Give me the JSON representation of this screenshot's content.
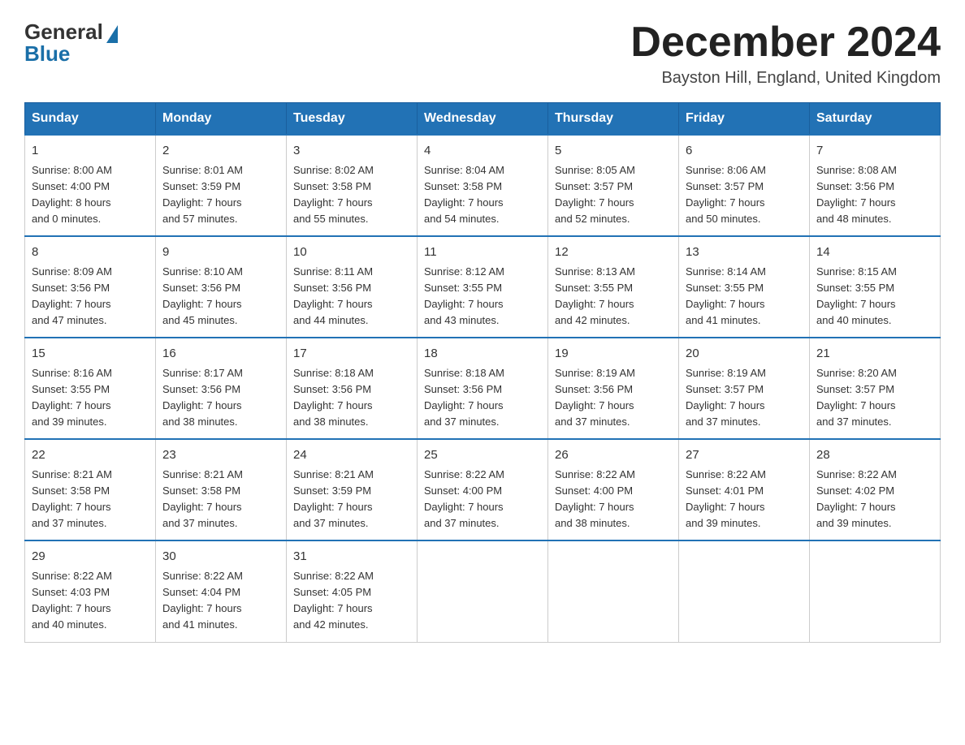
{
  "logo": {
    "general": "General",
    "blue": "Blue"
  },
  "header": {
    "month": "December 2024",
    "location": "Bayston Hill, England, United Kingdom"
  },
  "days_of_week": [
    "Sunday",
    "Monday",
    "Tuesday",
    "Wednesday",
    "Thursday",
    "Friday",
    "Saturday"
  ],
  "weeks": [
    [
      {
        "num": "1",
        "info": "Sunrise: 8:00 AM\nSunset: 4:00 PM\nDaylight: 8 hours\nand 0 minutes."
      },
      {
        "num": "2",
        "info": "Sunrise: 8:01 AM\nSunset: 3:59 PM\nDaylight: 7 hours\nand 57 minutes."
      },
      {
        "num": "3",
        "info": "Sunrise: 8:02 AM\nSunset: 3:58 PM\nDaylight: 7 hours\nand 55 minutes."
      },
      {
        "num": "4",
        "info": "Sunrise: 8:04 AM\nSunset: 3:58 PM\nDaylight: 7 hours\nand 54 minutes."
      },
      {
        "num": "5",
        "info": "Sunrise: 8:05 AM\nSunset: 3:57 PM\nDaylight: 7 hours\nand 52 minutes."
      },
      {
        "num": "6",
        "info": "Sunrise: 8:06 AM\nSunset: 3:57 PM\nDaylight: 7 hours\nand 50 minutes."
      },
      {
        "num": "7",
        "info": "Sunrise: 8:08 AM\nSunset: 3:56 PM\nDaylight: 7 hours\nand 48 minutes."
      }
    ],
    [
      {
        "num": "8",
        "info": "Sunrise: 8:09 AM\nSunset: 3:56 PM\nDaylight: 7 hours\nand 47 minutes."
      },
      {
        "num": "9",
        "info": "Sunrise: 8:10 AM\nSunset: 3:56 PM\nDaylight: 7 hours\nand 45 minutes."
      },
      {
        "num": "10",
        "info": "Sunrise: 8:11 AM\nSunset: 3:56 PM\nDaylight: 7 hours\nand 44 minutes."
      },
      {
        "num": "11",
        "info": "Sunrise: 8:12 AM\nSunset: 3:55 PM\nDaylight: 7 hours\nand 43 minutes."
      },
      {
        "num": "12",
        "info": "Sunrise: 8:13 AM\nSunset: 3:55 PM\nDaylight: 7 hours\nand 42 minutes."
      },
      {
        "num": "13",
        "info": "Sunrise: 8:14 AM\nSunset: 3:55 PM\nDaylight: 7 hours\nand 41 minutes."
      },
      {
        "num": "14",
        "info": "Sunrise: 8:15 AM\nSunset: 3:55 PM\nDaylight: 7 hours\nand 40 minutes."
      }
    ],
    [
      {
        "num": "15",
        "info": "Sunrise: 8:16 AM\nSunset: 3:55 PM\nDaylight: 7 hours\nand 39 minutes."
      },
      {
        "num": "16",
        "info": "Sunrise: 8:17 AM\nSunset: 3:56 PM\nDaylight: 7 hours\nand 38 minutes."
      },
      {
        "num": "17",
        "info": "Sunrise: 8:18 AM\nSunset: 3:56 PM\nDaylight: 7 hours\nand 38 minutes."
      },
      {
        "num": "18",
        "info": "Sunrise: 8:18 AM\nSunset: 3:56 PM\nDaylight: 7 hours\nand 37 minutes."
      },
      {
        "num": "19",
        "info": "Sunrise: 8:19 AM\nSunset: 3:56 PM\nDaylight: 7 hours\nand 37 minutes."
      },
      {
        "num": "20",
        "info": "Sunrise: 8:19 AM\nSunset: 3:57 PM\nDaylight: 7 hours\nand 37 minutes."
      },
      {
        "num": "21",
        "info": "Sunrise: 8:20 AM\nSunset: 3:57 PM\nDaylight: 7 hours\nand 37 minutes."
      }
    ],
    [
      {
        "num": "22",
        "info": "Sunrise: 8:21 AM\nSunset: 3:58 PM\nDaylight: 7 hours\nand 37 minutes."
      },
      {
        "num": "23",
        "info": "Sunrise: 8:21 AM\nSunset: 3:58 PM\nDaylight: 7 hours\nand 37 minutes."
      },
      {
        "num": "24",
        "info": "Sunrise: 8:21 AM\nSunset: 3:59 PM\nDaylight: 7 hours\nand 37 minutes."
      },
      {
        "num": "25",
        "info": "Sunrise: 8:22 AM\nSunset: 4:00 PM\nDaylight: 7 hours\nand 37 minutes."
      },
      {
        "num": "26",
        "info": "Sunrise: 8:22 AM\nSunset: 4:00 PM\nDaylight: 7 hours\nand 38 minutes."
      },
      {
        "num": "27",
        "info": "Sunrise: 8:22 AM\nSunset: 4:01 PM\nDaylight: 7 hours\nand 39 minutes."
      },
      {
        "num": "28",
        "info": "Sunrise: 8:22 AM\nSunset: 4:02 PM\nDaylight: 7 hours\nand 39 minutes."
      }
    ],
    [
      {
        "num": "29",
        "info": "Sunrise: 8:22 AM\nSunset: 4:03 PM\nDaylight: 7 hours\nand 40 minutes."
      },
      {
        "num": "30",
        "info": "Sunrise: 8:22 AM\nSunset: 4:04 PM\nDaylight: 7 hours\nand 41 minutes."
      },
      {
        "num": "31",
        "info": "Sunrise: 8:22 AM\nSunset: 4:05 PM\nDaylight: 7 hours\nand 42 minutes."
      },
      null,
      null,
      null,
      null
    ]
  ]
}
